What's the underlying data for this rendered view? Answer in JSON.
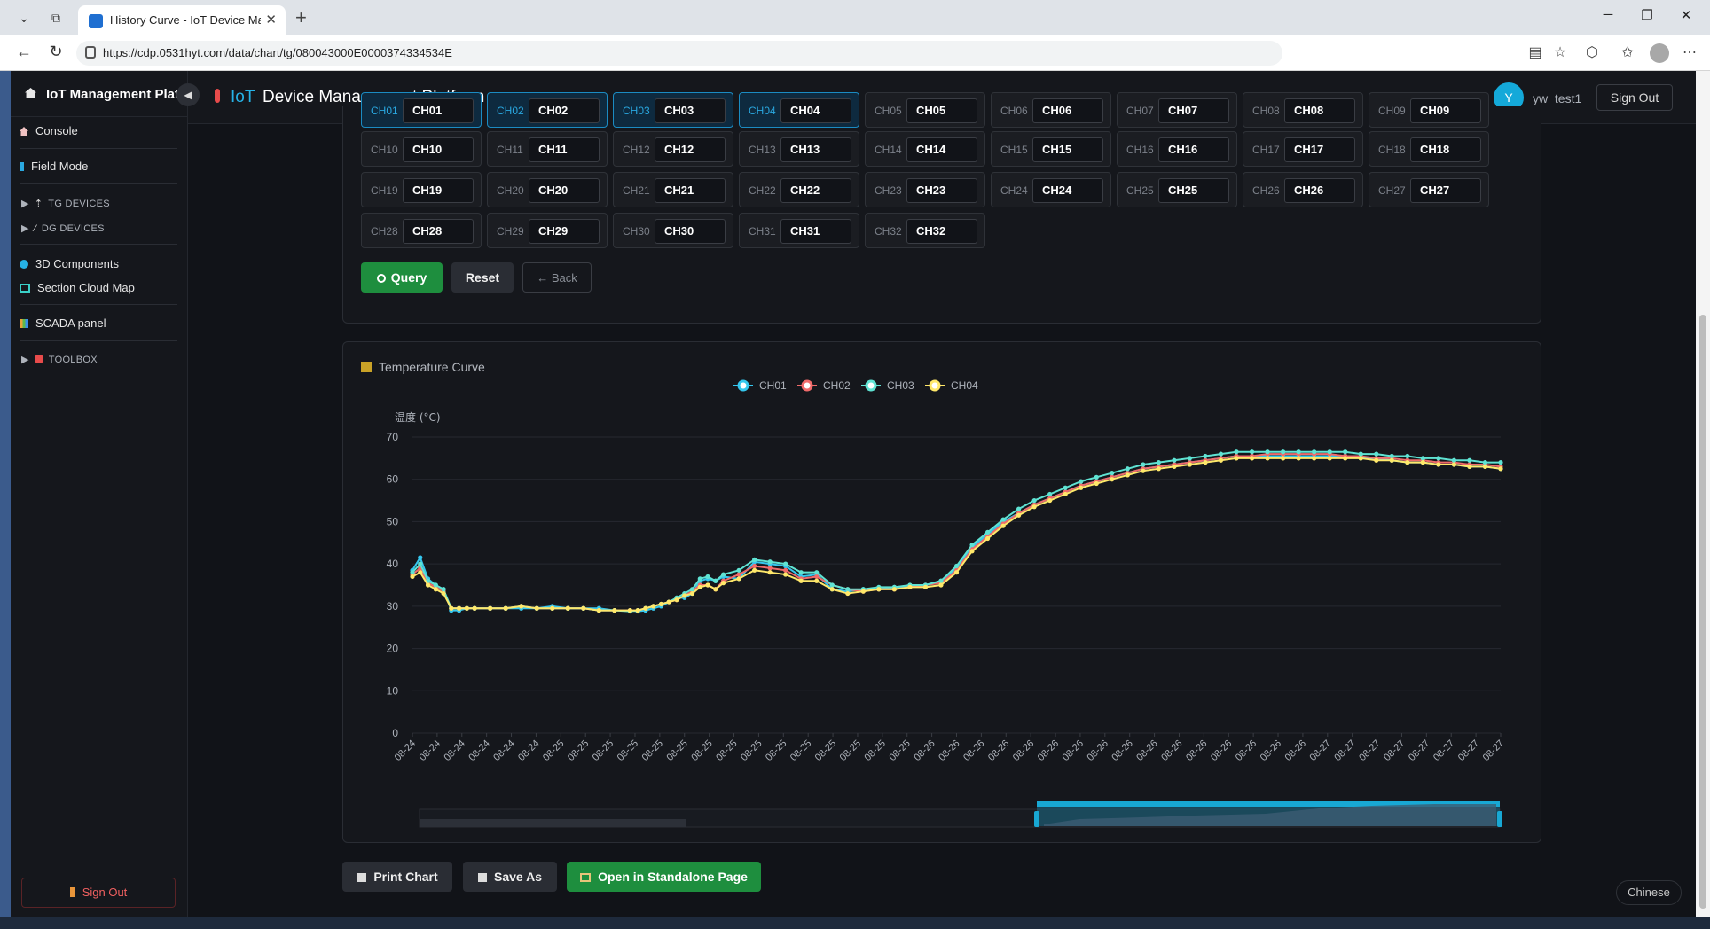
{
  "browser": {
    "tab_title": "History Curve - IoT Device Management Platform",
    "url": "https://cdp.0531hyt.com/data/chart/tg/080043000E0000374334534E"
  },
  "sidebar": {
    "title": "IoT Management Platform",
    "items": [
      {
        "label": "Console"
      },
      {
        "label": "Field Mode"
      },
      {
        "label": "TG DEVICES"
      },
      {
        "label": "DG DEVICES"
      },
      {
        "label": "3D Components"
      },
      {
        "label": "Section Cloud Map"
      },
      {
        "label": "SCADA panel"
      },
      {
        "label": "TOOLBOX"
      }
    ],
    "signout": "Sign Out"
  },
  "topbar": {
    "brand": "IoT",
    "title": "Device Management Platform",
    "avatar_letter": "Y",
    "username": "yw_test1",
    "signout": "Sign Out"
  },
  "channels": [
    {
      "label": "CH01",
      "value": "CH01",
      "selected": true
    },
    {
      "label": "CH02",
      "value": "CH02",
      "selected": true
    },
    {
      "label": "CH03",
      "value": "CH03",
      "selected": true
    },
    {
      "label": "CH04",
      "value": "CH04",
      "selected": true
    },
    {
      "label": "CH05",
      "value": "CH05",
      "selected": false
    },
    {
      "label": "CH06",
      "value": "CH06",
      "selected": false
    },
    {
      "label": "CH07",
      "value": "CH07",
      "selected": false
    },
    {
      "label": "CH08",
      "value": "CH08",
      "selected": false
    },
    {
      "label": "CH09",
      "value": "CH09",
      "selected": false
    },
    {
      "label": "CH10",
      "value": "CH10",
      "selected": false
    },
    {
      "label": "CH11",
      "value": "CH11",
      "selected": false
    },
    {
      "label": "CH12",
      "value": "CH12",
      "selected": false
    },
    {
      "label": "CH13",
      "value": "CH13",
      "selected": false
    },
    {
      "label": "CH14",
      "value": "CH14",
      "selected": false
    },
    {
      "label": "CH15",
      "value": "CH15",
      "selected": false
    },
    {
      "label": "CH16",
      "value": "CH16",
      "selected": false
    },
    {
      "label": "CH17",
      "value": "CH17",
      "selected": false
    },
    {
      "label": "CH18",
      "value": "CH18",
      "selected": false
    },
    {
      "label": "CH19",
      "value": "CH19",
      "selected": false
    },
    {
      "label": "CH20",
      "value": "CH20",
      "selected": false
    },
    {
      "label": "CH21",
      "value": "CH21",
      "selected": false
    },
    {
      "label": "CH22",
      "value": "CH22",
      "selected": false
    },
    {
      "label": "CH23",
      "value": "CH23",
      "selected": false
    },
    {
      "label": "CH24",
      "value": "CH24",
      "selected": false
    },
    {
      "label": "CH25",
      "value": "CH25",
      "selected": false
    },
    {
      "label": "CH26",
      "value": "CH26",
      "selected": false
    },
    {
      "label": "CH27",
      "value": "CH27",
      "selected": false
    },
    {
      "label": "CH28",
      "value": "CH28",
      "selected": false
    },
    {
      "label": "CH29",
      "value": "CH29",
      "selected": false
    },
    {
      "label": "CH30",
      "value": "CH30",
      "selected": false
    },
    {
      "label": "CH31",
      "value": "CH31",
      "selected": false
    },
    {
      "label": "CH32",
      "value": "CH32",
      "selected": false
    }
  ],
  "actions": {
    "query": "Query",
    "reset": "Reset",
    "back": "← Back"
  },
  "chart_panel_title": "Temperature Curve",
  "footer": {
    "print": "Print Chart",
    "save": "Save As",
    "standalone": "Open in Standalone Page",
    "language": "Chinese"
  },
  "colors": {
    "accent": "#26b2e6",
    "query": "#1e8e3e",
    "danger": "#f06060"
  },
  "chart_data": {
    "type": "line",
    "ylabel": "温度 (°C)",
    "ylim": [
      0,
      70
    ],
    "yticks": [
      0,
      10,
      20,
      30,
      40,
      50,
      60,
      70
    ],
    "x_tick_labels": [
      "08-24",
      "08-24",
      "08-24",
      "08-24",
      "08-24",
      "08-24",
      "08-25",
      "08-25",
      "08-25",
      "08-25",
      "08-25",
      "08-25",
      "08-25",
      "08-25",
      "08-25",
      "08-25",
      "08-25",
      "08-25",
      "08-25",
      "08-25",
      "08-25",
      "08-26",
      "08-26",
      "08-26",
      "08-26",
      "08-26",
      "08-26",
      "08-26",
      "08-26",
      "08-26",
      "08-26",
      "08-26",
      "08-26",
      "08-26",
      "08-26",
      "08-26",
      "08-26",
      "08-27",
      "08-27",
      "08-27",
      "08-27",
      "08-27",
      "08-27",
      "08-27",
      "08-27"
    ],
    "legend_position": "top-center",
    "grid": true,
    "x_index": [
      0,
      2,
      4,
      6,
      8,
      10,
      12,
      14,
      16,
      20,
      24,
      28,
      32,
      36,
      40,
      44,
      48,
      52,
      56,
      58,
      60,
      62,
      64,
      66,
      68,
      70,
      72,
      74,
      76,
      78,
      80,
      84,
      88,
      92,
      96,
      100,
      104,
      108,
      112,
      116,
      120,
      124,
      128,
      132,
      136,
      140,
      144,
      148,
      152,
      156,
      160,
      164,
      168,
      172,
      176,
      180,
      184,
      188,
      192,
      196,
      200,
      204,
      208,
      212,
      216,
      220,
      224,
      228,
      232,
      236,
      240,
      244,
      248,
      252,
      256,
      260,
      264,
      268,
      272,
      276,
      280
    ],
    "series": [
      {
        "name": "CH01",
        "color": "#35c7ee",
        "values": [
          38.5,
          41.5,
          36.5,
          35,
          34,
          29,
          29,
          29.5,
          29.5,
          29.5,
          29.5,
          29.5,
          29.5,
          30,
          29.5,
          29.5,
          29.5,
          29,
          29,
          28.8,
          29,
          29.5,
          30,
          31,
          32,
          32,
          33,
          36,
          36.5,
          36,
          37,
          36.5,
          40.5,
          40,
          39.5,
          37,
          37.5,
          34,
          33.5,
          34,
          34,
          34.5,
          34.5,
          35,
          36,
          39,
          44,
          47,
          50,
          52,
          54,
          55.5,
          57,
          58.5,
          59.5,
          60.5,
          61.5,
          62.5,
          63,
          63.5,
          64,
          64.5,
          65,
          65.5,
          65.5,
          65.5,
          65.5,
          65.5,
          65.5,
          65.5,
          65.5,
          65,
          65,
          64.5,
          64,
          64,
          63.5,
          63.5,
          63,
          63,
          62.5
        ]
      },
      {
        "name": "CH02",
        "color": "#f06a6a",
        "values": [
          37.5,
          39,
          35.5,
          34.5,
          33.5,
          29.5,
          29.5,
          29.5,
          29.5,
          29.5,
          29.5,
          30,
          29.5,
          29.5,
          29.5,
          29.5,
          29,
          29,
          29,
          29,
          29.5,
          30,
          30.5,
          31,
          31.5,
          32.5,
          33.5,
          35,
          35,
          34,
          36,
          37.5,
          39.5,
          39,
          38.5,
          36.5,
          37,
          35,
          34,
          33.5,
          34,
          34,
          34.5,
          35,
          35.5,
          38.5,
          43.5,
          46.5,
          49.5,
          52,
          54,
          55.5,
          57,
          58.5,
          59.5,
          60.5,
          61.5,
          62.5,
          63,
          63.5,
          64,
          64.5,
          65,
          65.5,
          65.5,
          66,
          66,
          66,
          66,
          66,
          65.5,
          65.5,
          65,
          65,
          64.5,
          64.5,
          64,
          64,
          63.5,
          63.5,
          63
        ]
      },
      {
        "name": "CH03",
        "color": "#5fe3d3",
        "values": [
          38,
          40,
          36,
          35,
          34,
          29.5,
          29.5,
          29.5,
          29.5,
          29.5,
          29.5,
          30,
          29.5,
          29.5,
          29.5,
          29.5,
          29,
          29,
          28.8,
          29,
          29.5,
          30,
          30.5,
          31,
          32,
          33,
          34,
          36.5,
          37,
          36,
          37.5,
          38.5,
          41,
          40.5,
          40,
          38,
          38,
          35,
          34,
          34,
          34.5,
          34.5,
          35,
          35,
          36,
          39.5,
          44.5,
          47.5,
          50.5,
          53,
          55,
          56.5,
          58,
          59.5,
          60.5,
          61.5,
          62.5,
          63.5,
          64,
          64.5,
          65,
          65.5,
          66,
          66.5,
          66.5,
          66.5,
          66.5,
          66.5,
          66.5,
          66.5,
          66.5,
          66,
          66,
          65.5,
          65.5,
          65,
          65,
          64.5,
          64.5,
          64,
          64
        ]
      },
      {
        "name": "CH04",
        "color": "#ffe86a",
        "values": [
          37,
          38,
          35,
          34,
          33,
          29.5,
          29.5,
          29.5,
          29.5,
          29.5,
          29.5,
          30,
          29.5,
          29.5,
          29.5,
          29.5,
          29,
          29,
          29,
          29,
          29.5,
          30,
          30.5,
          31,
          31.5,
          32.5,
          33,
          34.5,
          35,
          34,
          35.5,
          36.5,
          38.5,
          38,
          37.5,
          36,
          36,
          34,
          33,
          33.5,
          34,
          34,
          34.5,
          34.5,
          35,
          38,
          43,
          46,
          49,
          51.5,
          53.5,
          55,
          56.5,
          58,
          59,
          60,
          61,
          62,
          62.5,
          63,
          63.5,
          64,
          64.5,
          65,
          65,
          65,
          65,
          65,
          65,
          65,
          65,
          65,
          64.5,
          64.5,
          64,
          64,
          63.5,
          63.5,
          63,
          63,
          62.5
        ]
      }
    ]
  }
}
